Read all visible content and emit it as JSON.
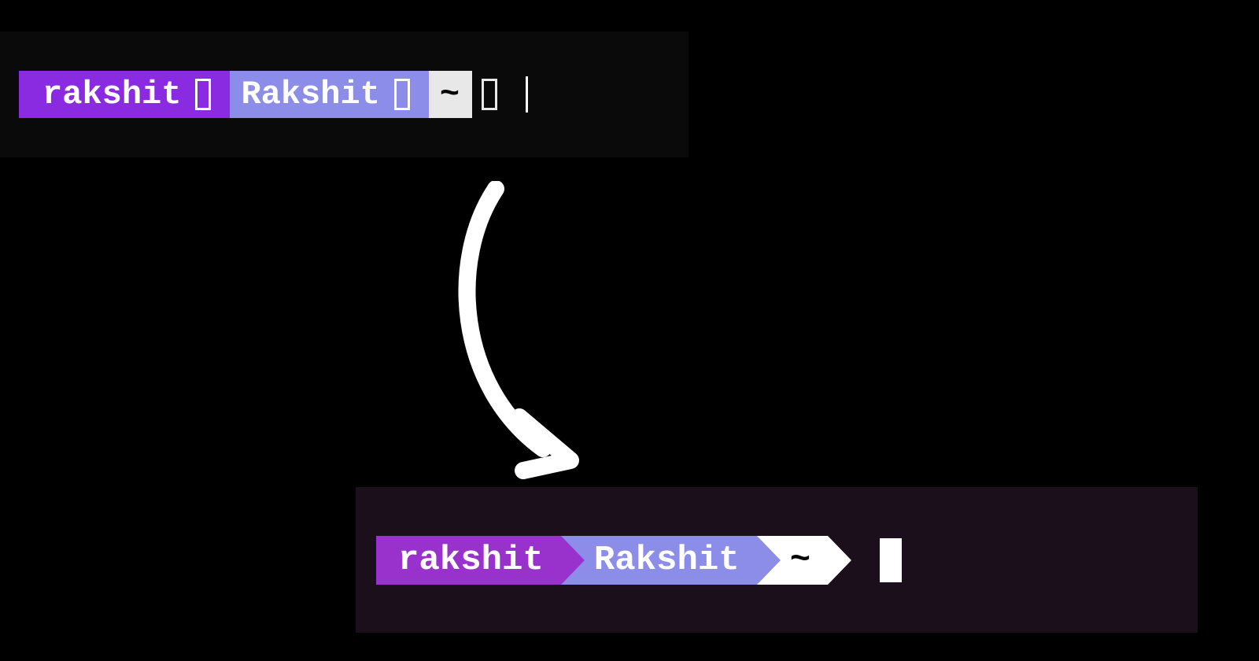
{
  "before": {
    "user": "rakshit",
    "host": "Rakshit",
    "path": "~",
    "broken_glyph": "▯"
  },
  "after": {
    "user": "rakshit",
    "host": "Rakshit",
    "path": "~"
  }
}
